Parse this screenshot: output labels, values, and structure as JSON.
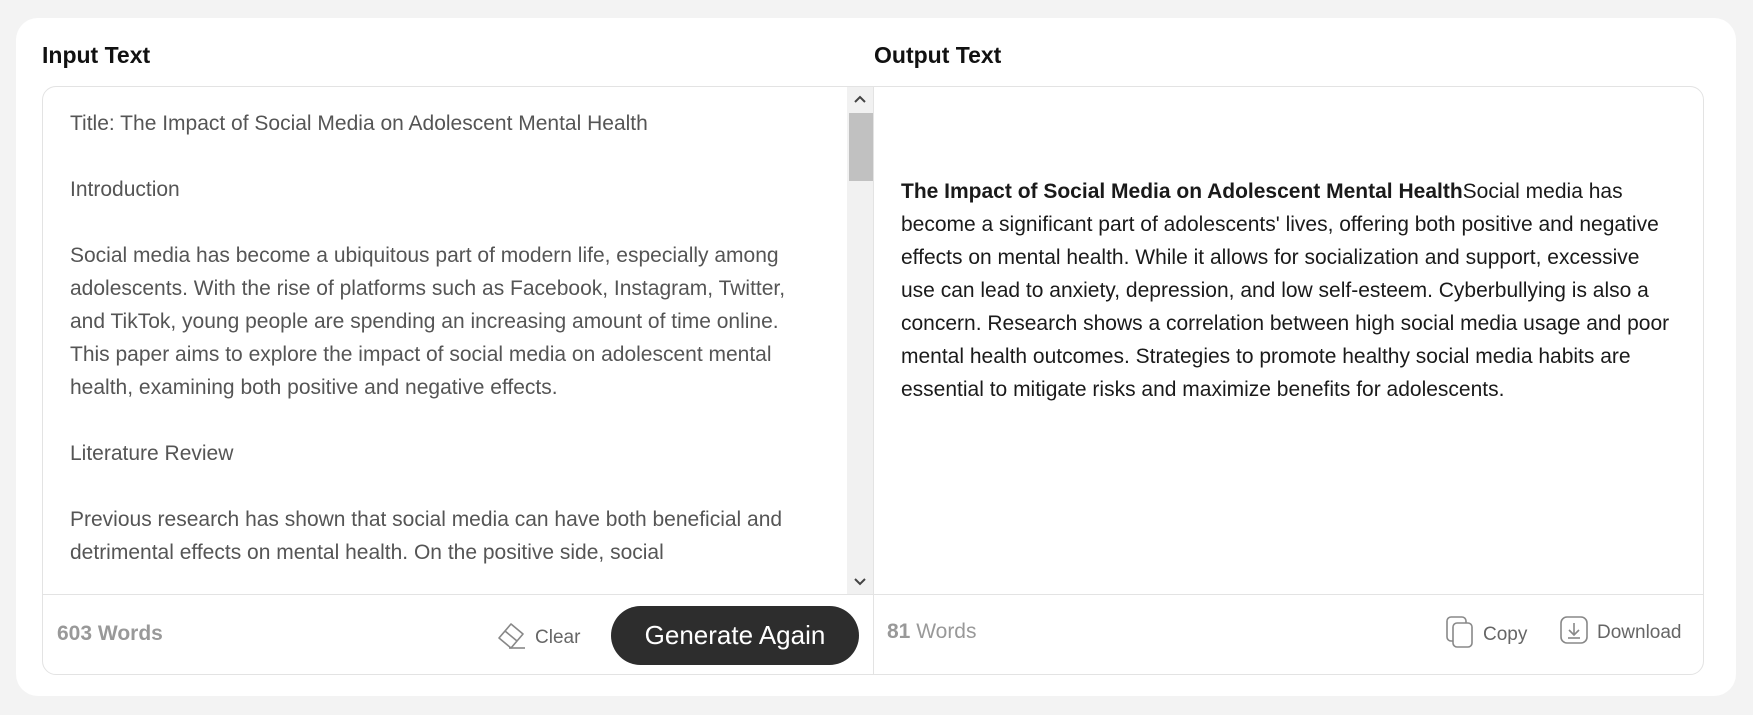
{
  "input": {
    "title": "Input Text",
    "paragraphs": [
      "Title: The Impact of Social Media on Adolescent Mental Health",
      "Introduction",
      "Social media has become a ubiquitous part of modern life, especially among adolescents. With the rise of platforms such as Facebook, Instagram, Twitter, and TikTok, young people are spending an increasing amount of time online. This paper aims to explore the impact of social media on adolescent mental health, examining both positive and negative effects.",
      "Literature Review",
      "Previous research has shown that social media can have both beneficial and detrimental effects on mental health. On the positive side, social"
    ],
    "word_count": "603 Words",
    "clear_label": "Clear",
    "generate_label": "Generate Again"
  },
  "output": {
    "title": "Output Text",
    "heading": "The Impact of Social Media on Adolescent Mental Health",
    "body": "Social media has become a significant part of adolescents' lives, offering both positive and negative effects on mental health. While it allows for socialization and support, excessive use can lead to anxiety, depression, and low self-esteem. Cyberbullying is also a concern. Research shows a correlation between high social media usage and poor mental health outcomes. Strategies to promote healthy social media habits are essential to mitigate risks and maximize benefits for adolescents.",
    "word_count_number": "81",
    "word_count_suffix": " Words",
    "copy_label": "Copy",
    "download_label": "Download"
  },
  "icons": {
    "clear": "eraser-icon",
    "copy": "copy-icon",
    "download": "download-icon",
    "scroll_up": "chevron-up-icon",
    "scroll_down": "chevron-down-icon"
  },
  "colors": {
    "generate_button_bg": "#2d2d2d",
    "card_bg": "#ffffff",
    "page_bg": "#f3f3f3"
  }
}
